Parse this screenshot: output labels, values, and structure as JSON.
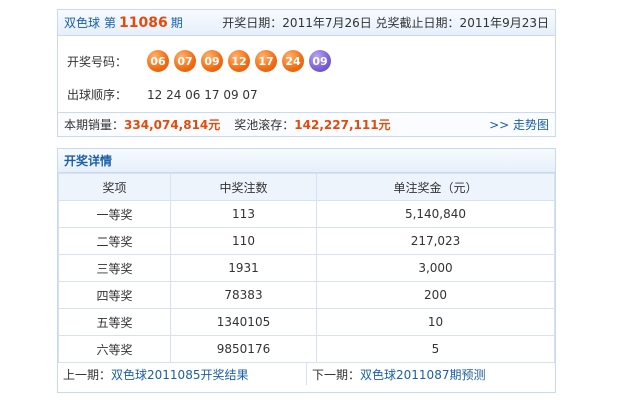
{
  "header": {
    "game": "双色球",
    "period_label": "第",
    "issue": "11086",
    "issue_suffix": "期",
    "dates": "开奖日期：2011年7月26日 兑奖截止日期：2011年9月23日"
  },
  "draw": {
    "numbers_label": "开奖号码：",
    "red": [
      "06",
      "07",
      "09",
      "12",
      "17",
      "24"
    ],
    "blue": "09",
    "order_label": "出球顺序：",
    "order": "12 24 06 17 09 07"
  },
  "summary": {
    "sales_label": "本期销量：",
    "sales": "334,074,814元",
    "pool_label": "奖池滚存：",
    "pool": "142,227,111元",
    "trend": ">> 走势图"
  },
  "detail": {
    "title": "开奖详情",
    "columns": [
      "奖项",
      "中奖注数",
      "单注奖金（元）"
    ],
    "rows": [
      [
        "一等奖",
        "113",
        "5,140,840"
      ],
      [
        "二等奖",
        "110",
        "217,023"
      ],
      [
        "三等奖",
        "1931",
        "3,000"
      ],
      [
        "四等奖",
        "78383",
        "200"
      ],
      [
        "五等奖",
        "1340105",
        "10"
      ],
      [
        "六等奖",
        "9850176",
        "5"
      ]
    ],
    "prev_label": "上一期：",
    "prev_link": "双色球2011085开奖结果",
    "next_label": "下一期：",
    "next_link": "双色球2011087期预测"
  }
}
